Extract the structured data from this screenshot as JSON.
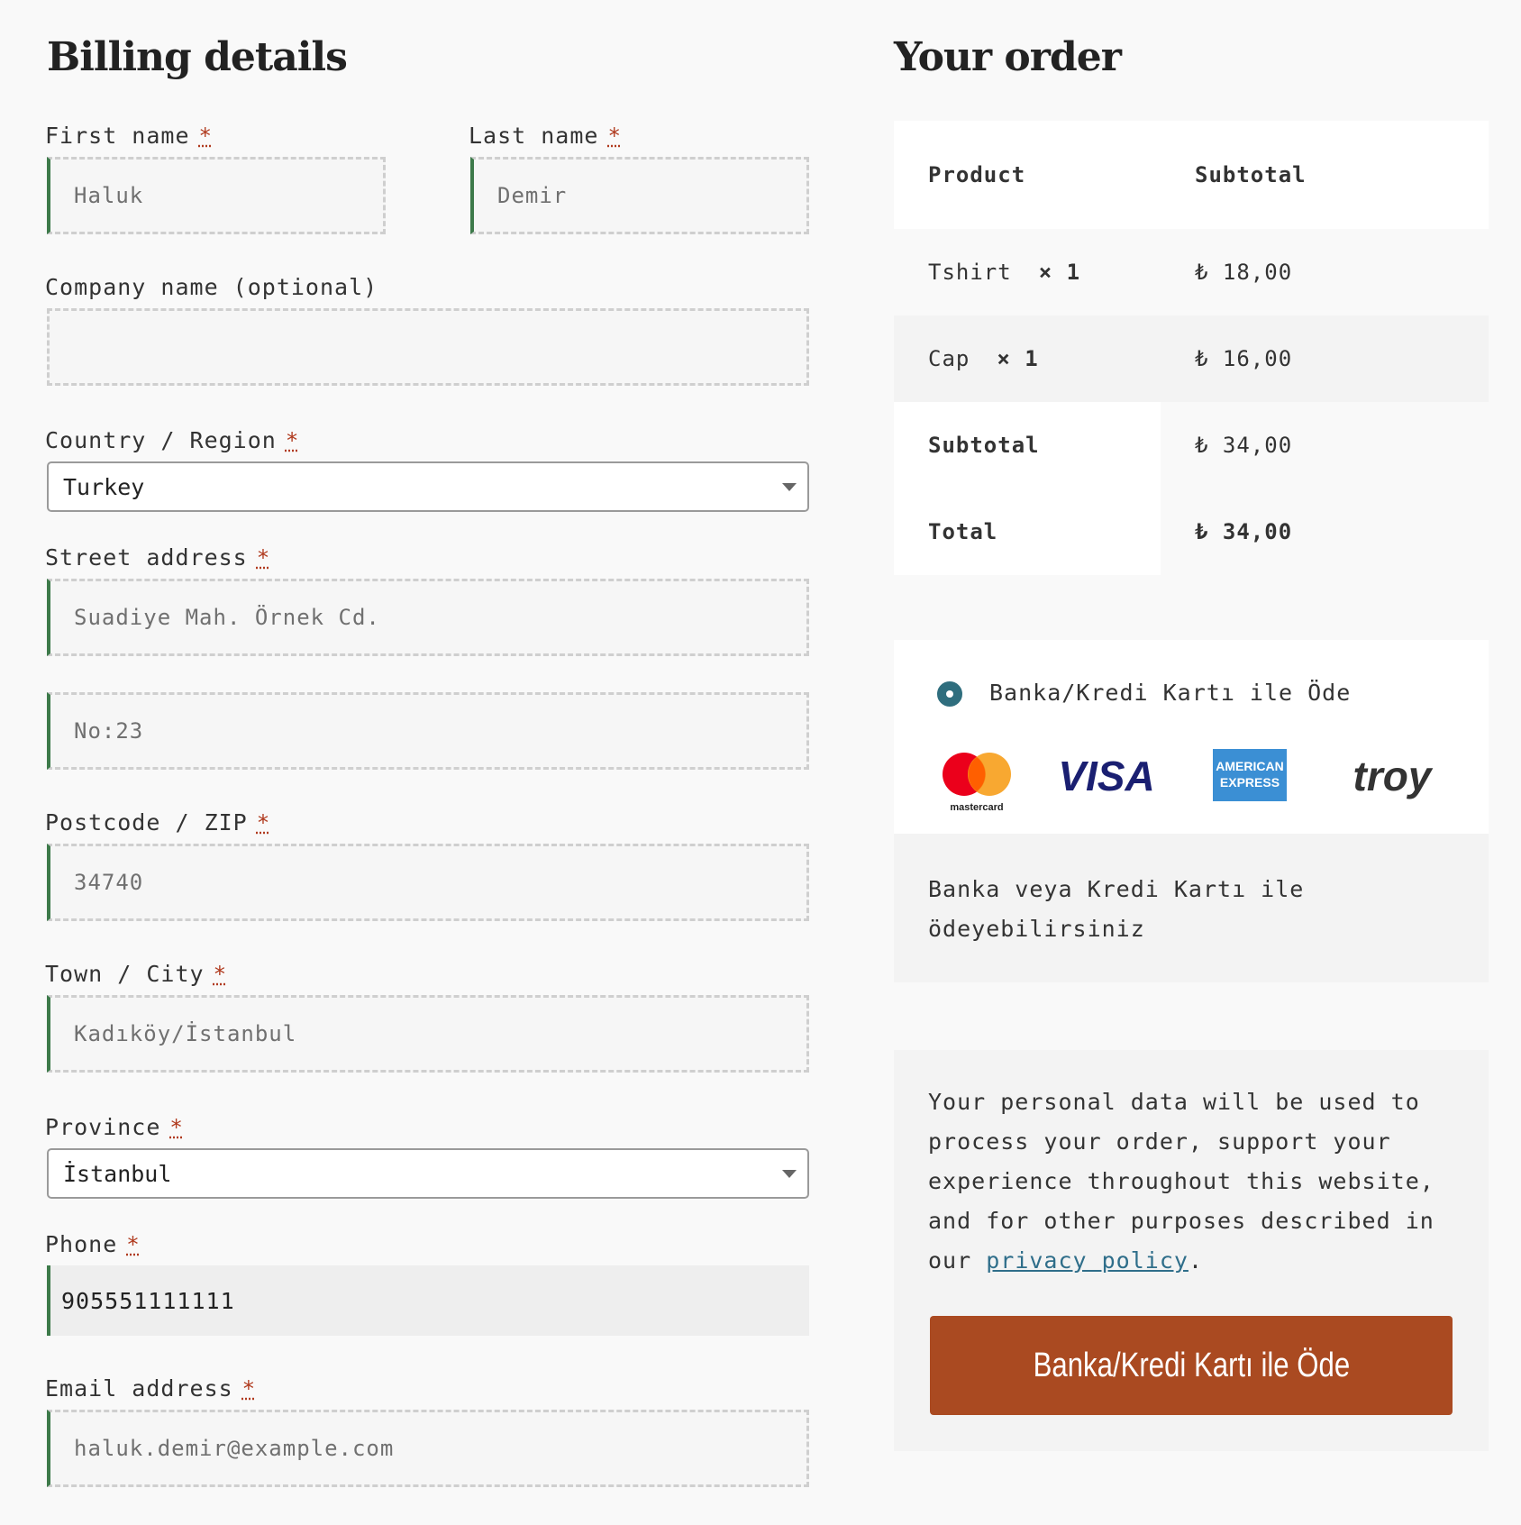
{
  "billing": {
    "heading": "Billing details",
    "required_mark": "*",
    "first_name": {
      "label": "First name",
      "value": "Haluk"
    },
    "last_name": {
      "label": "Last name",
      "value": "Demir"
    },
    "company": {
      "label": "Company name (optional)",
      "value": ""
    },
    "country": {
      "label": "Country / Region",
      "value": "Turkey"
    },
    "street": {
      "label": "Street address",
      "line1": "Suadiye Mah. Örnek Cd.",
      "line2": "No:23"
    },
    "postcode": {
      "label": "Postcode / ZIP",
      "value": "34740"
    },
    "city": {
      "label": "Town / City",
      "value": "Kadıköy/İstanbul"
    },
    "province": {
      "label": "Province",
      "value": "İstanbul"
    },
    "phone": {
      "label": "Phone",
      "value": "905551111111"
    },
    "email": {
      "label": "Email address",
      "value": "haluk.demir@example.com"
    }
  },
  "order": {
    "heading": "Your order",
    "col_product": "Product",
    "col_subtotal": "Subtotal",
    "items": [
      {
        "name": "Tshirt",
        "qty": "× 1",
        "price": "₺ 18,00"
      },
      {
        "name": "Cap",
        "qty": "× 1",
        "price": "₺ 16,00"
      }
    ],
    "subtotal_label": "Subtotal",
    "subtotal_value": "₺ 34,00",
    "total_label": "Total",
    "total_value": "₺ 34,00"
  },
  "payment": {
    "method_label": "Banka/Kredi Kartı ile Öde",
    "card_logos": [
      "mastercard",
      "VISA",
      "AMERICAN",
      "EXPRESS",
      "troy"
    ],
    "description": "Banka veya Kredi Kartı ile ödeyebilirsiniz",
    "privacy_before": "Your personal data will be used to process your order, support your experience throughout this website, and for other purposes described in our ",
    "privacy_link": "privacy policy",
    "privacy_after": ".",
    "place_order": "Banka/Kredi Kartı ile Öde"
  },
  "colors": {
    "accent": "#aa4a21",
    "valid": "#3d7a4a",
    "required": "#b03a1e",
    "link": "#2f6e8a"
  }
}
